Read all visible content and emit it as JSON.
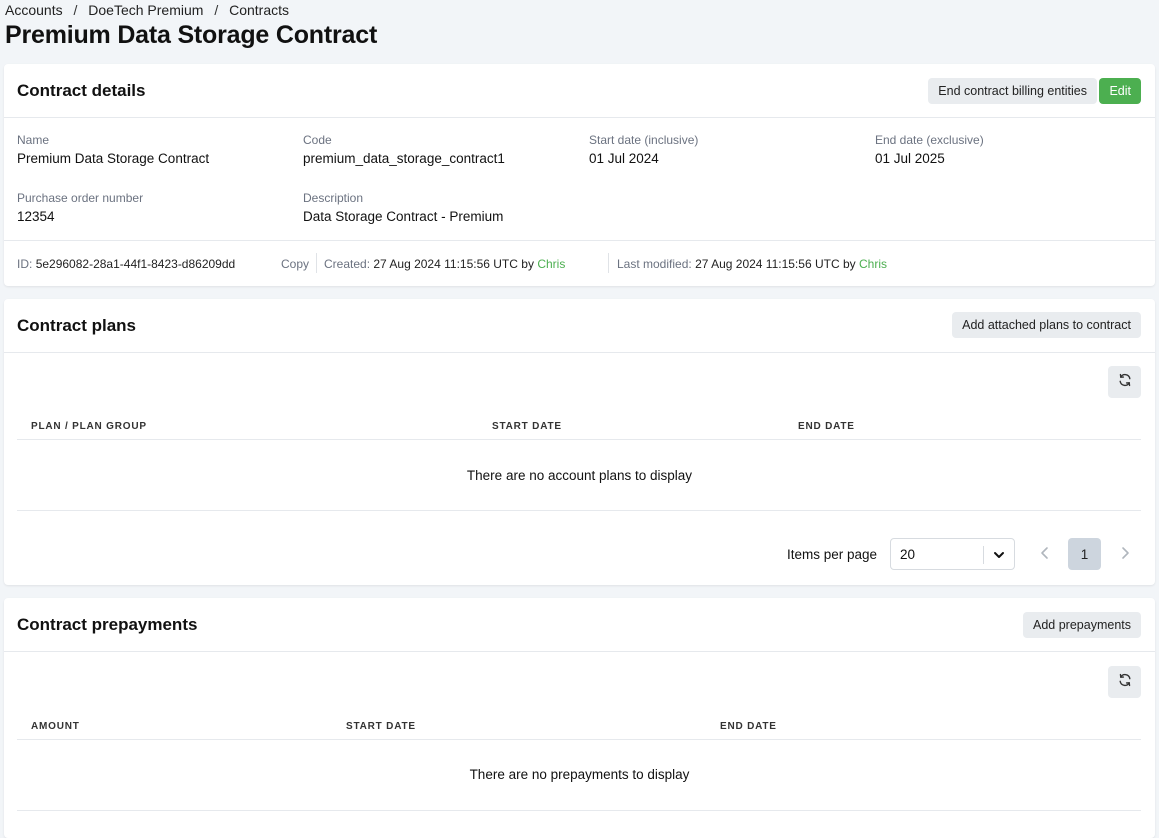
{
  "breadcrumb": {
    "items": [
      "Accounts",
      "DoeTech Premium",
      "Contracts"
    ],
    "separator": "/"
  },
  "page": {
    "title": "Premium Data Storage Contract"
  },
  "contract_details": {
    "title": "Contract details",
    "buttons": {
      "end_billing": "End contract billing entities",
      "edit": "Edit"
    },
    "fields": {
      "name": {
        "label": "Name",
        "value": "Premium Data Storage Contract"
      },
      "code": {
        "label": "Code",
        "value": "premium_data_storage_contract1"
      },
      "start": {
        "label": "Start date (inclusive)",
        "value": "01 Jul 2024"
      },
      "end": {
        "label": "End date (exclusive)",
        "value": "01 Jul 2025"
      },
      "po": {
        "label": "Purchase order number",
        "value": "12354"
      },
      "description": {
        "label": "Description",
        "value": "Data Storage Contract - Premium"
      }
    },
    "meta": {
      "id_label": "ID:",
      "id_value": "5e296082-28a1-44f1-8423-d86209dd",
      "copy": "Copy",
      "created_label": "Created:",
      "created_value": "27 Aug 2024 11:15:56 UTC",
      "by1": "by",
      "created_by": "Chris",
      "modified_label": "Last modified:",
      "modified_value": "27 Aug 2024 11:15:56 UTC",
      "by2": "by",
      "modified_by": "Chris"
    }
  },
  "contract_plans": {
    "title": "Contract plans",
    "add_button": "Add attached plans to contract",
    "columns": [
      "PLAN / PLAN GROUP",
      "START DATE",
      "END DATE"
    ],
    "empty_message": "There are no account plans to display",
    "pagination": {
      "items_per_page_label": "Items per page",
      "items_per_page": "20",
      "current_page": "1"
    }
  },
  "contract_prepayments": {
    "title": "Contract prepayments",
    "add_button": "Add prepayments",
    "columns": [
      "AMOUNT",
      "START DATE",
      "END DATE"
    ],
    "empty_message": "There are no prepayments to display"
  },
  "colors": {
    "accent_green": "#4caf50",
    "button_gray": "#e9ecef",
    "page_bg": "#f2f5f8",
    "active_page_bg": "#cdd5de"
  },
  "icons": {
    "refresh": "refresh-icon",
    "chevron_down": "chevron-down-icon",
    "chevron_left": "chevron-left-icon",
    "chevron_right": "chevron-right-icon"
  }
}
